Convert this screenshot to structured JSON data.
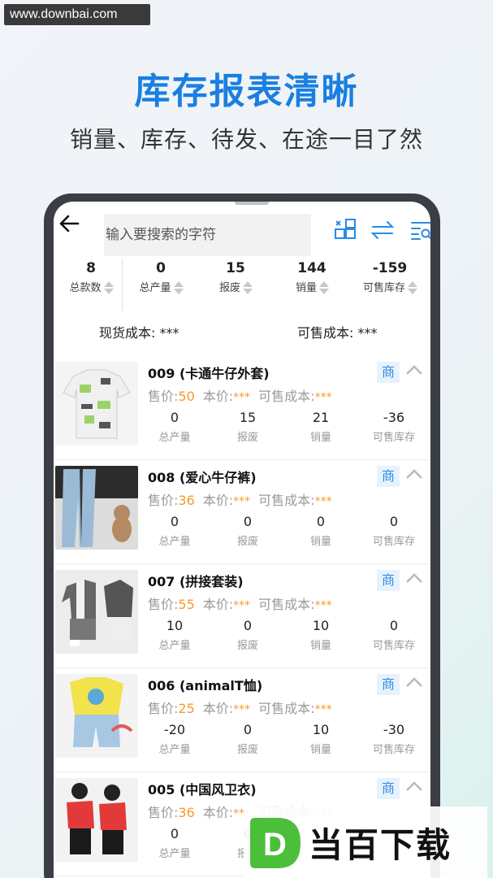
{
  "watermark": "www.downbai.com",
  "headline": "库存报表清晰",
  "subline": "销量、库存、待发、在途一目了然",
  "search": {
    "placeholder": "输入要搜索的字符"
  },
  "summary": [
    {
      "value": "8",
      "label": "总款数"
    },
    {
      "value": "0",
      "label": "总产量"
    },
    {
      "value": "15",
      "label": "报废"
    },
    {
      "value": "144",
      "label": "销量"
    },
    {
      "value": "-159",
      "label": "可售库存"
    }
  ],
  "cost": {
    "spot": "现货成本: ***",
    "sellable": "可售成本: ***"
  },
  "labels": {
    "price": "售价:",
    "cost": "本价:",
    "sell_cost": "可售成本:",
    "badge": "商",
    "m1": "总产量",
    "m2": "报废",
    "m3": "销量",
    "m4": "可售库存"
  },
  "products": [
    {
      "title": "009 (卡通牛仔外套)",
      "price": "50",
      "cost": "***",
      "sell_cost": "***",
      "m1": "0",
      "m2": "15",
      "m3": "21",
      "m4": "-36"
    },
    {
      "title": "008 (爱心牛仔裤)",
      "price": "36",
      "cost": "***",
      "sell_cost": "***",
      "m1": "0",
      "m2": "0",
      "m3": "0",
      "m4": "0"
    },
    {
      "title": "007 (拼接套装)",
      "price": "55",
      "cost": "***",
      "sell_cost": "***",
      "m1": "10",
      "m2": "0",
      "m3": "10",
      "m4": "0"
    },
    {
      "title": "006 (animalT恤)",
      "price": "25",
      "cost": "***",
      "sell_cost": "***",
      "m1": "-20",
      "m2": "0",
      "m3": "10",
      "m4": "-30"
    },
    {
      "title": "005 (中国风卫衣)",
      "price": "36",
      "cost": "***",
      "sell_cost": "***",
      "m1": "0",
      "m2": "0",
      "m3": "",
      "m4": ""
    }
  ],
  "logo": {
    "text": "当百下载",
    "letter": "D"
  },
  "colors": {
    "accent": "#1a7fe0",
    "price": "#f19c2a",
    "badge": "#2a8ae8",
    "logo_green": "#4cbf3a"
  }
}
